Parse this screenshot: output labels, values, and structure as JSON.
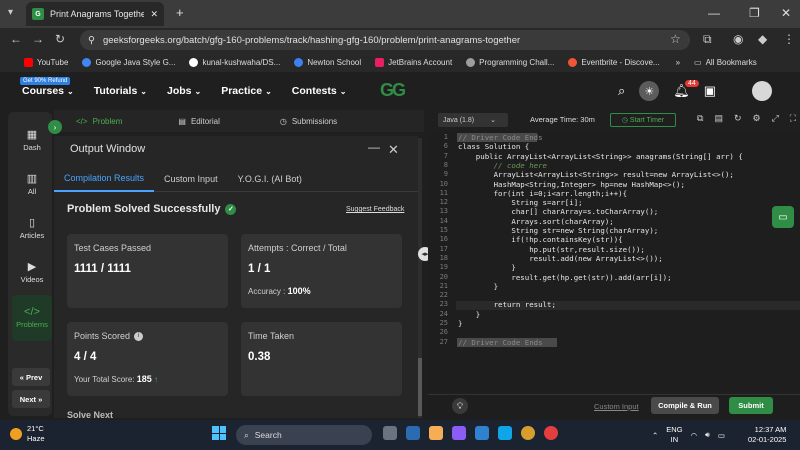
{
  "browser": {
    "tab_title": "Print Anagrams Together | Prac",
    "url": "geeksforgeeks.org/batch/gfg-160-problems/track/hashing-gfg-160/problem/print-anagrams-together",
    "bookmarks": [
      {
        "label": "YouTube",
        "color": "#ff0000"
      },
      {
        "label": "Google Java Style G...",
        "color": "#4285f4"
      },
      {
        "label": "kunal-kushwaha/DS...",
        "color": "#ffffff"
      },
      {
        "label": "Newton School",
        "color": "#3b82f6"
      },
      {
        "label": "JetBrains Account",
        "color": "#e91e63"
      },
      {
        "label": "Programming Chall...",
        "color": "#9e9e9e"
      },
      {
        "label": "Eventbrite - Discove...",
        "color": "#f05537"
      }
    ],
    "all_bookmarks": "All Bookmarks"
  },
  "site": {
    "promo": "Get 90% Refund",
    "nav": [
      "Courses",
      "Tutorials",
      "Jobs",
      "Practice",
      "Contests"
    ],
    "logo": "GG",
    "notifications": "44"
  },
  "sidebar": {
    "items": [
      "Dash",
      "All",
      "Articles",
      "Videos",
      "Problems"
    ],
    "prev": "Prev",
    "next": "Next"
  },
  "problem_tabs": [
    "Problem",
    "Editorial",
    "Submissions"
  ],
  "output": {
    "title": "Output Window",
    "tabs": [
      "Compilation Results",
      "Custom Input",
      "Y.O.G.I. (AI Bot)"
    ],
    "status": "Problem Solved Successfully",
    "feedback": "Suggest Feedback",
    "cards": {
      "tests_label": "Test Cases Passed",
      "tests_value": "1111 / 1111",
      "attempts_label": "Attempts : Correct / Total",
      "attempts_value": "1 / 1",
      "accuracy_label": "Accuracy :",
      "accuracy_value": "100%",
      "points_label": "Points Scored",
      "points_value": "4 / 4",
      "total_label": "Your Total Score:",
      "total_value": "185",
      "time_label": "Time Taken",
      "time_value": "0.38"
    },
    "solve_next": "Solve Next"
  },
  "editor": {
    "language": "Java (1.8)",
    "avg_time": "Average Time: 30m",
    "timer": "Start Timer",
    "lines": [
      {
        "n": "1",
        "t": "// Driver Code Ends",
        "k": "fold"
      },
      {
        "n": "6",
        "t": "class Solution {",
        "k": "code"
      },
      {
        "n": "7",
        "t": "    public ArrayList<ArrayList<String>> anagrams(String[] arr) {",
        "k": "code"
      },
      {
        "n": "8",
        "t": "        // code here",
        "k": "comment"
      },
      {
        "n": "9",
        "t": "        ArrayList<ArrayList<String>> result=new ArrayList<>();",
        "k": "code"
      },
      {
        "n": "10",
        "t": "        HashMap<String,Integer> hp=new HashMap<>();",
        "k": "code"
      },
      {
        "n": "11",
        "t": "        for(int i=0;i<arr.length;i++){",
        "k": "code"
      },
      {
        "n": "12",
        "t": "            String s=arr[i];",
        "k": "code"
      },
      {
        "n": "13",
        "t": "            char[] charArray=s.toCharArray();",
        "k": "code"
      },
      {
        "n": "14",
        "t": "            Arrays.sort(charArray);",
        "k": "code"
      },
      {
        "n": "15",
        "t": "            String str=new String(charArray);",
        "k": "code"
      },
      {
        "n": "16",
        "t": "            if(!hp.containsKey(str)){",
        "k": "code"
      },
      {
        "n": "17",
        "t": "                hp.put(str,result.size());",
        "k": "code"
      },
      {
        "n": "18",
        "t": "                result.add(new ArrayList<>());",
        "k": "code"
      },
      {
        "n": "19",
        "t": "            }",
        "k": "code"
      },
      {
        "n": "20",
        "t": "            result.get(hp.get(str)).add(arr[i]);",
        "k": "code"
      },
      {
        "n": "21",
        "t": "        }",
        "k": "code"
      },
      {
        "n": "22",
        "t": "",
        "k": "code"
      },
      {
        "n": "23",
        "t": "        return result;",
        "k": "code"
      },
      {
        "n": "24",
        "t": "    }",
        "k": "code"
      },
      {
        "n": "25",
        "t": "}",
        "k": "code"
      },
      {
        "n": "26",
        "t": "",
        "k": "code"
      },
      {
        "n": "27",
        "t": "// Driver Code Ends",
        "k": "fold"
      }
    ],
    "custom_input": "Custom Input",
    "compile": "Compile & Run",
    "submit": "Submit"
  },
  "taskbar": {
    "temp": "21°C",
    "weather": "Haze",
    "search": "Search",
    "lang1": "ENG",
    "lang2": "IN",
    "time": "12:37 AM",
    "date": "02-01-2025"
  }
}
